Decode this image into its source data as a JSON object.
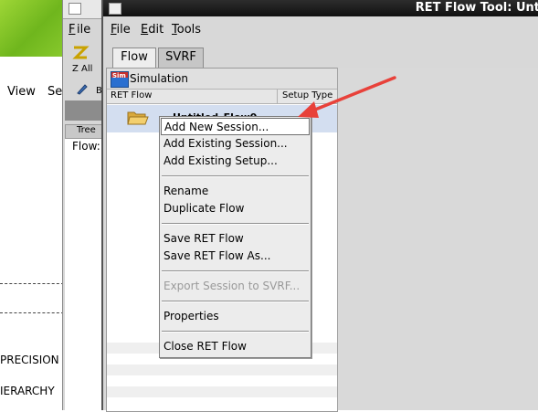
{
  "bg_window": {
    "menu": [
      "View",
      "Se"
    ],
    "text_lines": [
      "PRECISION",
      "IERARCHY"
    ]
  },
  "mid_window": {
    "zall_label": "Z All",
    "b_label": "B",
    "tree_label": "Tree",
    "flow_label": "Flow:"
  },
  "main_window": {
    "title": "RET Flow Tool: Unt",
    "menu": [
      {
        "label": "File"
      },
      {
        "label": "Edit"
      },
      {
        "label": "Tools"
      }
    ],
    "tabs": [
      {
        "label": "Flow",
        "active": true
      },
      {
        "label": "SVRF",
        "active": false
      }
    ],
    "panel": {
      "section": "Simulation",
      "sim_icon_text": "Sim",
      "columns": [
        "RET Flow",
        "Setup Type"
      ],
      "flow_item": "Untitled_Flow0"
    }
  },
  "context_menu": {
    "groups": [
      [
        {
          "label": "Add New Session...",
          "highlighted": true,
          "enabled": true
        },
        {
          "label": "Add Existing Session...",
          "enabled": true
        },
        {
          "label": "Add Existing Setup...",
          "enabled": true
        }
      ],
      [
        {
          "label": "Rename",
          "enabled": true
        },
        {
          "label": "Duplicate Flow",
          "enabled": true
        }
      ],
      [
        {
          "label": "Save RET Flow",
          "enabled": true
        },
        {
          "label": "Save RET Flow As...",
          "enabled": true
        }
      ],
      [
        {
          "label": "Export Session to SVRF...",
          "enabled": false
        }
      ],
      [
        {
          "label": "Properties",
          "enabled": true
        }
      ],
      [
        {
          "label": "Close RET Flow",
          "enabled": true
        }
      ]
    ]
  },
  "colors": {
    "arrow": "#e8413a",
    "selection_row": "#d3def0",
    "titlebar": "#1a1a1a"
  }
}
